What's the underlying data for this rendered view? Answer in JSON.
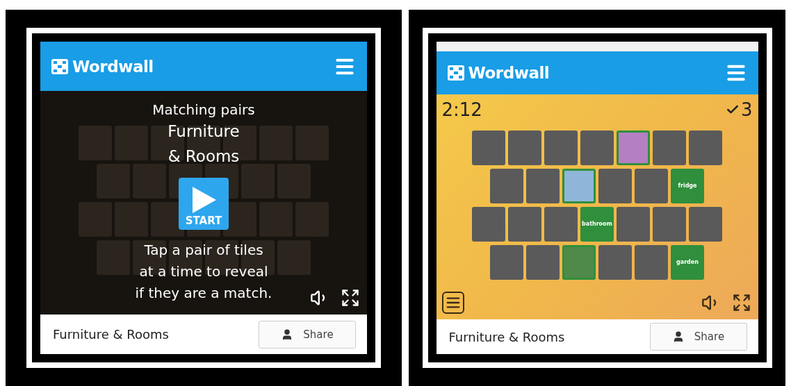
{
  "screens": [
    {
      "header": {
        "logo": "Wordwall"
      },
      "game": {
        "kind": "start",
        "title": "Matching pairs",
        "subtitle_lines": [
          "Furniture",
          "& Rooms"
        ],
        "start_button": "START",
        "instructions_lines": [
          "Tap a pair of tiles",
          "at a time to reveal",
          "if they are a match."
        ],
        "tile_rows": [
          [
            {
              "kind": "hidden"
            },
            {
              "kind": "hidden"
            },
            {
              "kind": "hidden"
            },
            {
              "kind": "hidden"
            },
            {
              "kind": "hidden"
            },
            {
              "kind": "hidden"
            },
            {
              "kind": "hidden"
            }
          ],
          [
            {
              "kind": "hidden"
            },
            {
              "kind": "hidden"
            },
            {
              "kind": "hidden"
            },
            {
              "kind": "hidden"
            },
            {
              "kind": "hidden"
            },
            {
              "kind": "hidden"
            }
          ],
          [
            {
              "kind": "hidden"
            },
            {
              "kind": "hidden"
            },
            {
              "kind": "hidden"
            },
            {
              "kind": "hidden"
            },
            {
              "kind": "hidden"
            },
            {
              "kind": "hidden"
            },
            {
              "kind": "hidden"
            }
          ],
          [
            {
              "kind": "hidden"
            },
            {
              "kind": "hidden"
            },
            {
              "kind": "hidden"
            },
            {
              "kind": "hidden"
            },
            {
              "kind": "hidden"
            },
            {
              "kind": "hidden"
            }
          ]
        ]
      },
      "footer": {
        "title": "Furniture & Rooms",
        "share_button": "Share"
      }
    },
    {
      "header": {
        "logo": "Wordwall"
      },
      "game": {
        "kind": "playing",
        "timer": "2:12",
        "score": "3",
        "tile_rows": [
          [
            {
              "kind": "hidden"
            },
            {
              "kind": "hidden"
            },
            {
              "kind": "hidden"
            },
            {
              "kind": "hidden"
            },
            {
              "kind": "image",
              "color": "#b57fc4"
            },
            {
              "kind": "hidden"
            },
            {
              "kind": "hidden"
            }
          ],
          [
            {
              "kind": "hidden"
            },
            {
              "kind": "hidden"
            },
            {
              "kind": "image",
              "color": "#8fb6d8"
            },
            {
              "kind": "hidden"
            },
            {
              "kind": "hidden"
            },
            {
              "kind": "word",
              "word": "fridge"
            }
          ],
          [
            {
              "kind": "hidden"
            },
            {
              "kind": "hidden"
            },
            {
              "kind": "hidden"
            },
            {
              "kind": "word",
              "word": "bathroom"
            },
            {
              "kind": "hidden"
            },
            {
              "kind": "hidden"
            },
            {
              "kind": "hidden"
            }
          ],
          [
            {
              "kind": "hidden"
            },
            {
              "kind": "hidden"
            },
            {
              "kind": "image",
              "color": "#4f8a4a"
            },
            {
              "kind": "hidden"
            },
            {
              "kind": "hidden"
            },
            {
              "kind": "word",
              "word": "garden"
            }
          ]
        ]
      },
      "footer": {
        "title": "Furniture & Rooms",
        "share_button": "Share"
      }
    }
  ]
}
